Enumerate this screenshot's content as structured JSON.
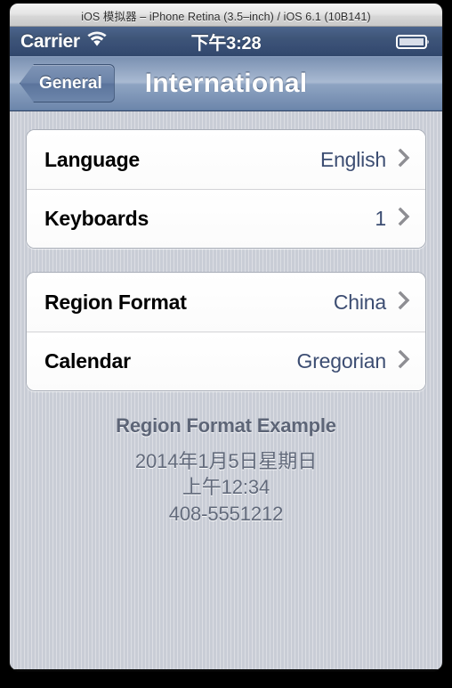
{
  "window": {
    "title": "iOS 模拟器 – iPhone Retina (3.5–inch) / iOS 6.1 (10B141)"
  },
  "status_bar": {
    "carrier": "Carrier",
    "wifi_icon": "wifi-icon",
    "time": "下午3:28",
    "battery_icon": "battery-full-icon"
  },
  "nav_bar": {
    "back_label": "General",
    "back_icon": "chevron-left-icon",
    "title": "International"
  },
  "groups": [
    {
      "rows": [
        {
          "label": "Language",
          "value": "English",
          "accessory": "chevron-right-icon"
        },
        {
          "label": "Keyboards",
          "value": "1",
          "accessory": "chevron-right-icon"
        }
      ]
    },
    {
      "rows": [
        {
          "label": "Region Format",
          "value": "China",
          "accessory": "chevron-right-icon"
        },
        {
          "label": "Calendar",
          "value": "Gregorian",
          "accessory": "chevron-right-icon"
        }
      ]
    }
  ],
  "footer": {
    "title": "Region Format Example",
    "lines": [
      "2014年1月5日星期日",
      "上午12:34",
      "408-5551212"
    ]
  },
  "colors": {
    "status_bar": "#3e5578",
    "nav_bar": "#8ea4c2",
    "value_text": "#3c4d72",
    "footer_text": "#626a7b",
    "screen_background": "#c9cdd6",
    "row_background": "#ffffff"
  }
}
